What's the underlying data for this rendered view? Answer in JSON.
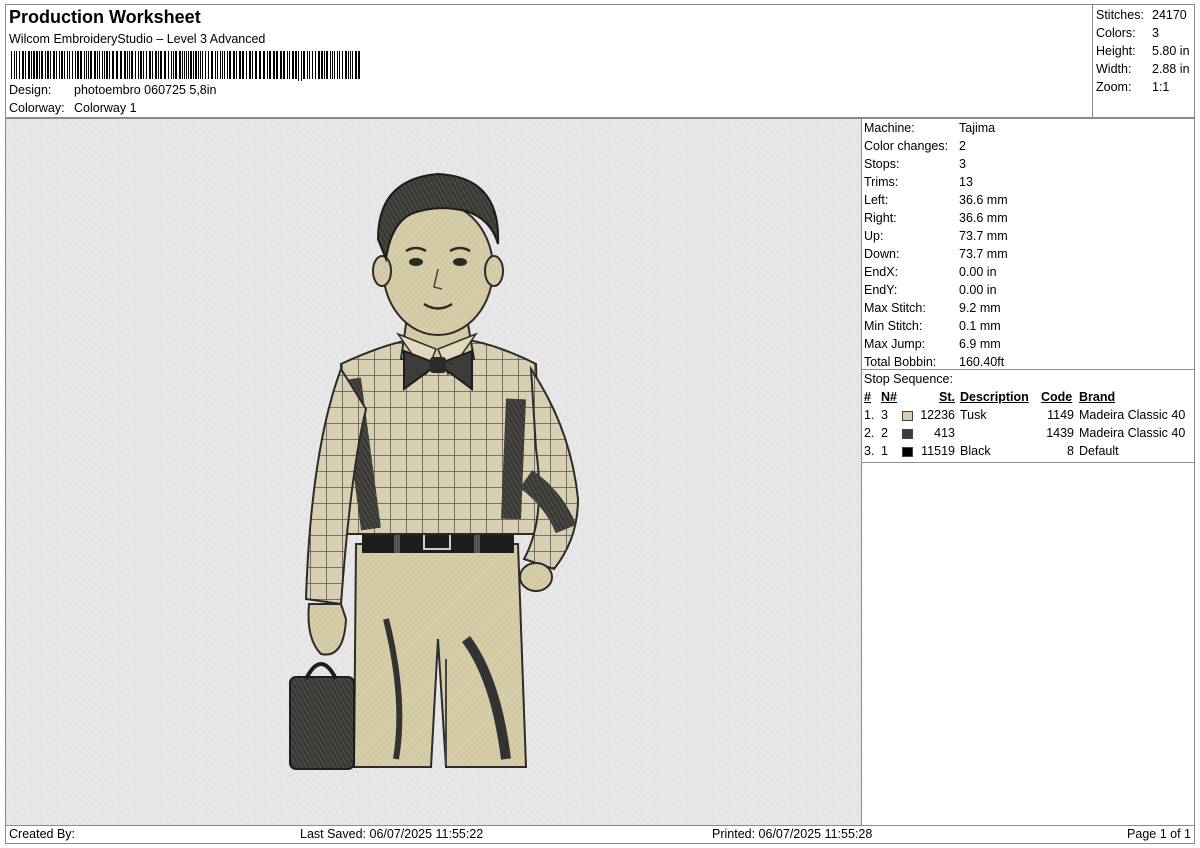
{
  "header": {
    "title": "Production Worksheet",
    "subtitle": "Wilcom EmbroideryStudio – Level 3 Advanced",
    "design_label": "Design:",
    "design_value": "photoembro 060725 5,8in",
    "colorway_label": "Colorway:",
    "colorway_value": "Colorway 1"
  },
  "stats": [
    {
      "label": "Stitches:",
      "value": "24170"
    },
    {
      "label": "Colors:",
      "value": "3"
    },
    {
      "label": "Height:",
      "value": "5.80 in"
    },
    {
      "label": "Width:",
      "value": "2.88 in"
    },
    {
      "label": "Zoom:",
      "value": "1:1"
    }
  ],
  "machine_info": [
    {
      "label": "Machine:",
      "value": "Tajima"
    },
    {
      "label": "Color changes:",
      "value": "2"
    },
    {
      "label": "Stops:",
      "value": "3"
    },
    {
      "label": "Trims:",
      "value": "13"
    },
    {
      "label": "Left:",
      "value": "36.6 mm"
    },
    {
      "label": "Right:",
      "value": "36.6 mm"
    },
    {
      "label": "Up:",
      "value": "73.7 mm"
    },
    {
      "label": "Down:",
      "value": "73.7 mm"
    },
    {
      "label": "EndX:",
      "value": "0.00 in"
    },
    {
      "label": "EndY:",
      "value": "0.00 in"
    },
    {
      "label": "Max Stitch:",
      "value": "9.2 mm"
    },
    {
      "label": "Min Stitch:",
      "value": "0.1 mm"
    },
    {
      "label": "Max Jump:",
      "value": "6.9 mm"
    },
    {
      "label": "Total Bobbin:",
      "value": "160.40ft"
    }
  ],
  "stop_sequence": {
    "title": "Stop Sequence:",
    "headers": {
      "num": "#",
      "n": "N#",
      "st": "St.",
      "description": "Description",
      "code": "Code",
      "brand": "Brand"
    },
    "rows": [
      {
        "num": "1.",
        "n": "3",
        "color": "#d9cbb4",
        "st": "12236",
        "description": "Tusk",
        "code": "1149",
        "brand": "Madeira Classic 40"
      },
      {
        "num": "2.",
        "n": "2",
        "color": "#3d3d3d",
        "st": "413",
        "description": "",
        "code": "1439",
        "brand": "Madeira Classic 40"
      },
      {
        "num": "3.",
        "n": "1",
        "color": "#000000",
        "st": "11519",
        "description": "Black",
        "code": "8",
        "brand": "Default"
      }
    ]
  },
  "footer": {
    "created_by": "Created By:",
    "last_saved": "Last Saved: 06/07/2025 11:55:22",
    "printed": "Printed: 06/07/2025 11:55:28",
    "page": "Page 1 of 1"
  }
}
